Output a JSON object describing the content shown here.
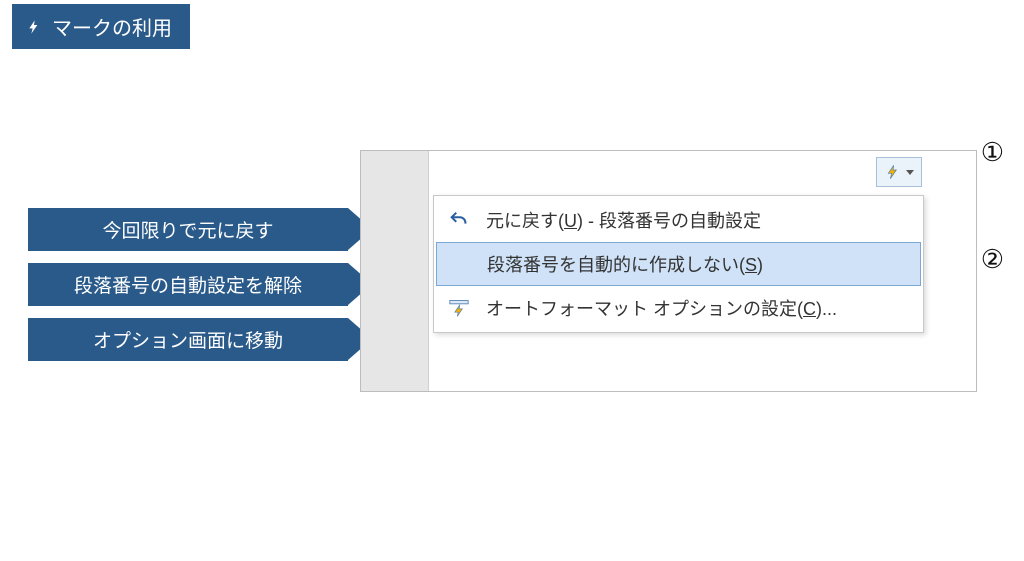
{
  "title": "マークの利用",
  "annotations": [
    "今回限りで元に戻す",
    "段落番号の自動設定を解除",
    "オプション画面に移動"
  ],
  "menu": {
    "items": [
      {
        "label_pre": "元に戻す(",
        "hotkey": "U",
        "label_post": ") - 段落番号の自動設定"
      },
      {
        "label_pre": "段落番号を自動的に作成しない(",
        "hotkey": "S",
        "label_post": ")"
      },
      {
        "label_pre": "オートフォーマット オプションの設定(",
        "hotkey": "C",
        "label_post": ")..."
      }
    ],
    "selected_index": 1
  },
  "callouts": [
    "①",
    "②"
  ],
  "colors": {
    "accent": "#2a5a8a",
    "menu_highlight": "#cfe2f7",
    "smarttag_bg": "#eaf2fa"
  }
}
